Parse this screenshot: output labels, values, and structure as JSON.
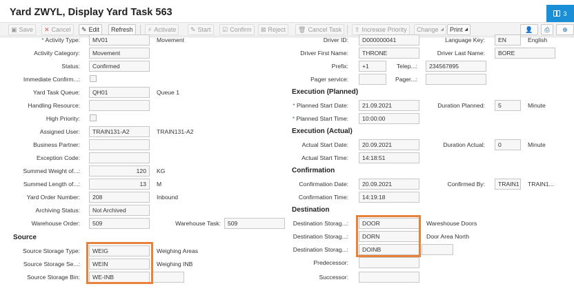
{
  "title": "Yard ZWYL, Display Yard Task 563",
  "messages_count": "3",
  "toolbar": {
    "save": "Save",
    "cancel": "Cancel",
    "edit": "Edit",
    "refresh": "Refresh",
    "activate": "Activate",
    "start": "Start",
    "confirm": "Confirm",
    "reject": "Reject",
    "cancel_task": "Cancel Task",
    "increase_priority": "Increase Priority",
    "change": "Change",
    "print": "Print"
  },
  "left": {
    "activity_type": {
      "label": "Activity Type:",
      "value": "MV01",
      "desc": "Movement"
    },
    "activity_category": {
      "label": "Activity Category:",
      "value": "Movement"
    },
    "status": {
      "label": "Status:",
      "value": "Confirmed"
    },
    "immediate_confirm": {
      "label": "Immediate Confirm...:"
    },
    "yard_task_queue": {
      "label": "Yard Task Queue:",
      "value": "QH01",
      "desc": "Queue 1"
    },
    "handling_resource": {
      "label": "Handling Resource:",
      "value": ""
    },
    "high_priority": {
      "label": "High Priority:"
    },
    "assigned_user": {
      "label": "Assigned User:",
      "value": "TRAIN131-A2",
      "desc": "TRAIN131-A2"
    },
    "business_partner": {
      "label": "Business Partner:",
      "value": ""
    },
    "exception_code": {
      "label": "Exception Code:",
      "value": ""
    },
    "summed_weight": {
      "label": "Summed Weight of...:",
      "value": "120",
      "unit": "KG"
    },
    "summed_length": {
      "label": "Summed Length of...:",
      "value": "13",
      "unit": "M"
    },
    "yard_order_number": {
      "label": "Yard Order Number:",
      "value": "208",
      "desc": "Inbound"
    },
    "archiving_status": {
      "label": "Archiving Status:",
      "value": "Not Archived"
    },
    "warehouse_order": {
      "label": "Warehouse Order:",
      "value": "509"
    },
    "warehouse_task": {
      "label": "Warehouse Task:",
      "value": "509"
    },
    "source_title": "Source",
    "source_storage_type": {
      "label": "Source Storage Type:",
      "value": "WEIG",
      "desc": "Weighing Areas"
    },
    "source_storage_section": {
      "label": "Source Storage Se...:",
      "value": "WEIN",
      "desc": "Weighing INB"
    },
    "source_storage_bin": {
      "label": "Source Storage Bin:",
      "value": "WE-INB"
    }
  },
  "right": {
    "driver_id": {
      "label": "Driver ID:",
      "value": "D000000041"
    },
    "language_key": {
      "label": "Language Key:",
      "value": "EN",
      "desc": "English"
    },
    "driver_first_name": {
      "label": "Driver First Name:",
      "value": "THRONE"
    },
    "driver_last_name": {
      "label": "Driver Last Name:",
      "value": "BORE"
    },
    "prefix": {
      "label": "Prefix:",
      "value": "+1"
    },
    "telephone": {
      "label": "Telep...:",
      "value": "234567895"
    },
    "pager_service": {
      "label": "Pager service:",
      "value": ""
    },
    "pager": {
      "label": "Pager...:",
      "value": ""
    },
    "execution_planned_title": "Execution (Planned)",
    "planned_start_date": {
      "label": "Planned Start Date:",
      "value": "21.09.2021"
    },
    "duration_planned": {
      "label": "Duration Planned:",
      "value": "5",
      "unit": "Minute"
    },
    "planned_start_time": {
      "label": "Planned Start Time:",
      "value": "10:00:00"
    },
    "execution_actual_title": "Execution (Actual)",
    "actual_start_date": {
      "label": "Actual Start Date:",
      "value": "20.09.2021"
    },
    "duration_actual": {
      "label": "Duration Actual:",
      "value": "0",
      "unit": "Minute"
    },
    "actual_start_time": {
      "label": "Actual Start Time:",
      "value": "14:18:51"
    },
    "confirmation_title": "Confirmation",
    "confirmation_date": {
      "label": "Confirmation Date:",
      "value": "20.09.2021"
    },
    "confirmed_by": {
      "label": "Confirmed By:",
      "value": "TRAIN1",
      "desc": "TRAIN1..."
    },
    "confirmation_time": {
      "label": "Confirmation Time:",
      "value": "14:19:18"
    },
    "destination_title": "Destination",
    "dest_storage_type": {
      "label": "Destination Storag...:",
      "value": "DOOR",
      "desc": "Wareshouse Doors"
    },
    "dest_storage_section": {
      "label": "Destination Storag...:",
      "value": "DORN",
      "desc": "Door Area North"
    },
    "dest_storage_bin": {
      "label": "Destination Storag...:",
      "value": "DOINB"
    },
    "predecessor": {
      "label": "Predecessor:",
      "value": ""
    },
    "successor": {
      "label": "Successor:",
      "value": ""
    }
  },
  "colors": {
    "accent": "#1a8fd8",
    "highlight": "#e8823a"
  }
}
